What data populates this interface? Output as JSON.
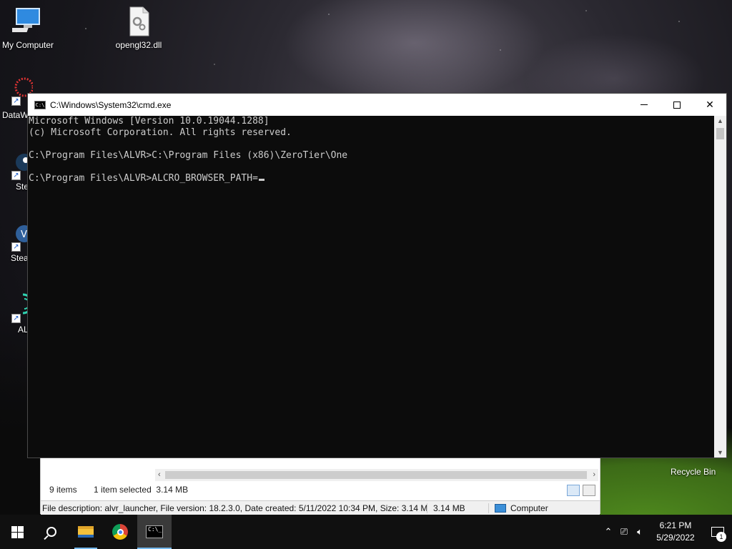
{
  "desktop": {
    "icons": [
      {
        "label": "My Computer"
      },
      {
        "label": "opengl32.dll"
      }
    ],
    "partial_labels": [
      "DataW",
      "Ste",
      "Stea",
      "AL"
    ],
    "recycle_bin": "Recycle Bin"
  },
  "explorer": {
    "item_count": "9 items",
    "selected": "1 item selected  3.14 MB",
    "details": "File description: alvr_launcher, File version: 18.2.3.0, Date created: 5/11/2022 10:34 PM, Size: 3.14 MB",
    "size": "3.14 MB",
    "location": "Computer"
  },
  "cmd": {
    "title": "C:\\Windows\\System32\\cmd.exe",
    "lines": [
      "Microsoft Windows [Version 10.0.19044.1288]",
      "(c) Microsoft Corporation. All rights reserved.",
      "",
      "C:\\Program Files\\ALVR>C:\\Program Files (x86)\\ZeroTier\\One",
      "",
      "C:\\Program Files\\ALVR>ALCRO_BROWSER_PATH="
    ]
  },
  "taskbar": {
    "time": "6:21 PM",
    "date": "5/29/2022",
    "notification_count": "1"
  }
}
